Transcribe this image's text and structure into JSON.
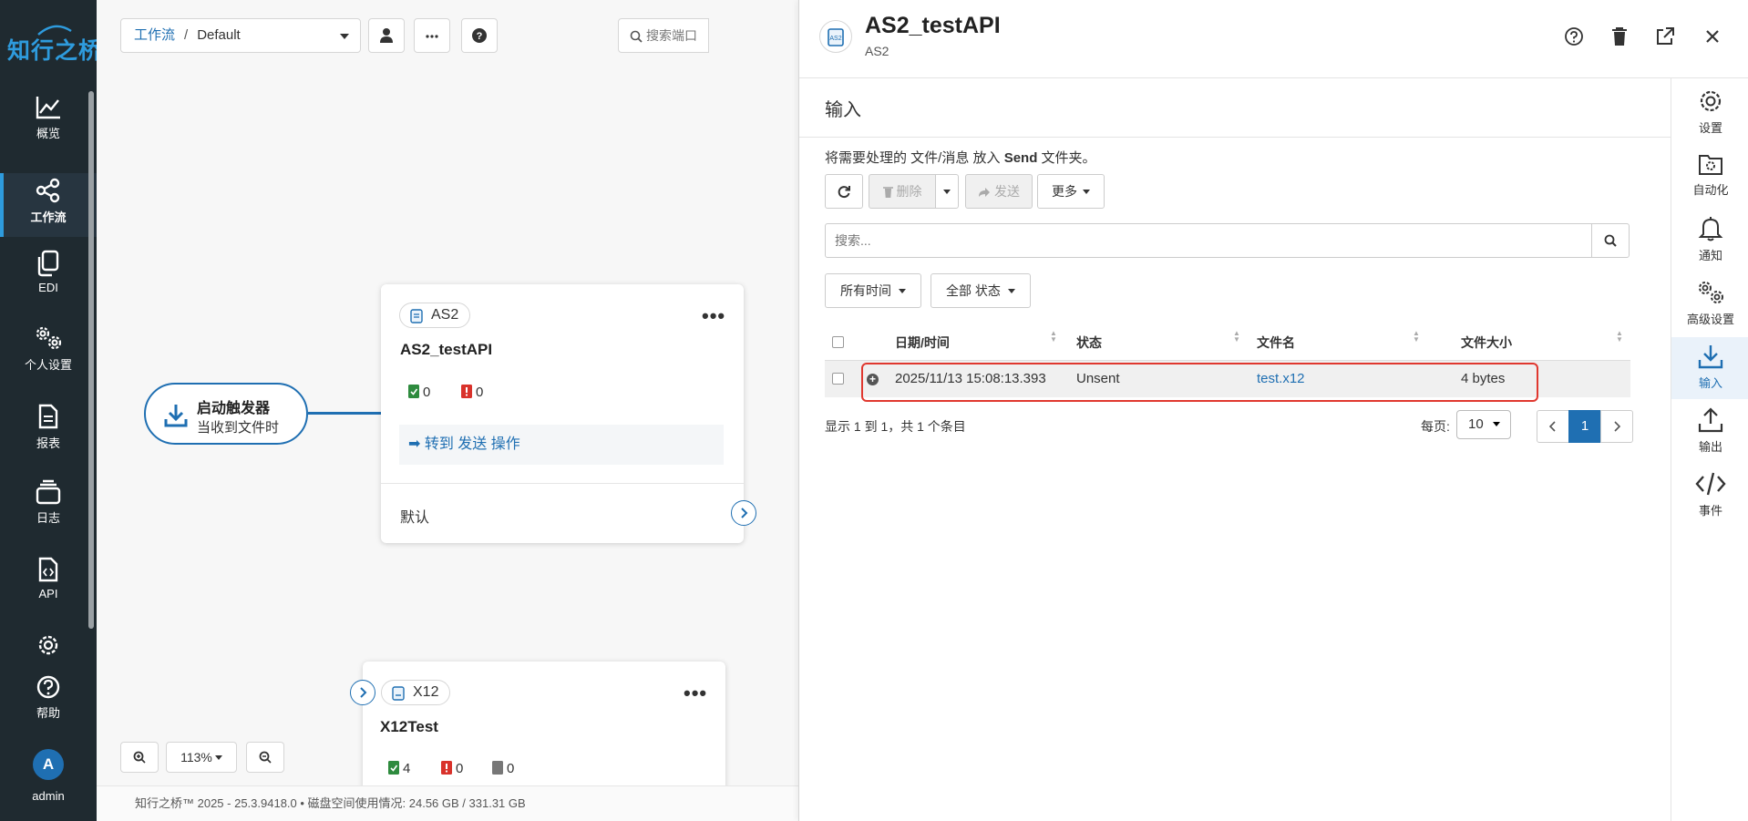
{
  "brand": {
    "logo_text": "知行之桥"
  },
  "nav": {
    "items": [
      {
        "label": "概览",
        "icon": "chart-line-icon"
      },
      {
        "label": "工作流",
        "icon": "workflow-icon"
      },
      {
        "label": "EDI",
        "icon": "copy-icon"
      },
      {
        "label": "个人设置",
        "icon": "gears-icon"
      },
      {
        "label": "报表",
        "icon": "document-icon"
      },
      {
        "label": "日志",
        "icon": "layers-icon"
      },
      {
        "label": "API",
        "icon": "code-file-icon"
      },
      {
        "label": "",
        "icon": "gear-icon"
      },
      {
        "label": "帮助",
        "icon": "help-circle-icon"
      }
    ],
    "active_index": 1,
    "user_initial": "A",
    "user_name": "admin"
  },
  "workflow": {
    "breadcrumb_root": "工作流",
    "breadcrumb_sep": "/",
    "breadcrumb_current": "Default",
    "search_placeholder": "搜索端口",
    "trigger": {
      "title": "启动触发器",
      "subtitle": "当收到文件时"
    },
    "node_as2": {
      "tag": "AS2",
      "title": "AS2_testAPI",
      "success": "0",
      "error": "0",
      "goto": "转到 发送 操作",
      "default_label": "默认"
    },
    "node_x12": {
      "tag": "X12",
      "title": "X12Test",
      "success": "4",
      "error": "0",
      "other": "0"
    },
    "zoom": "113%",
    "footer": "知行之桥™ 2025 - 25.3.9418.0  •  磁盘空间使用情况:  24.56 GB / 331.31 GB"
  },
  "panel": {
    "title": "AS2_testAPI",
    "subtitle": "AS2",
    "section": "输入",
    "desc_prefix": "将需要处理的 文件/消息 放入",
    "desc_folder": "Send",
    "desc_suffix": "文件夹。",
    "buttons": {
      "delete": "删除",
      "send": "发送",
      "more": "更多"
    },
    "search_placeholder": "搜索...",
    "filters": {
      "time": "所有时间",
      "status": "全部 状态"
    },
    "columns": [
      "日期/时间",
      "状态",
      "文件名",
      "文件大小"
    ],
    "rows": [
      {
        "datetime": "2025/11/13 15:08:13.393",
        "status": "Unsent",
        "filename": "test.x12",
        "size": "4 bytes"
      }
    ],
    "info": "显示 1 到 1，共 1 个条目",
    "per_page_label": "每页:",
    "per_page": "10",
    "page": "1",
    "tabs": [
      {
        "label": "设置",
        "icon": "gear-icon"
      },
      {
        "label": "自动化",
        "icon": "folder-gear-icon"
      },
      {
        "label": "通知",
        "icon": "bell-icon"
      },
      {
        "label": "高级设置",
        "icon": "gears-icon"
      },
      {
        "label": "输入",
        "icon": "download-icon"
      },
      {
        "label": "输出",
        "icon": "upload-icon"
      },
      {
        "label": "事件",
        "icon": "code-icon"
      }
    ],
    "active_tab": 4
  },
  "colors": {
    "accent": "#1f6fb2",
    "nav_bg": "#1f2a30",
    "highlight": "#e0382f",
    "success": "#2e8b3e",
    "error": "#d9322b"
  }
}
